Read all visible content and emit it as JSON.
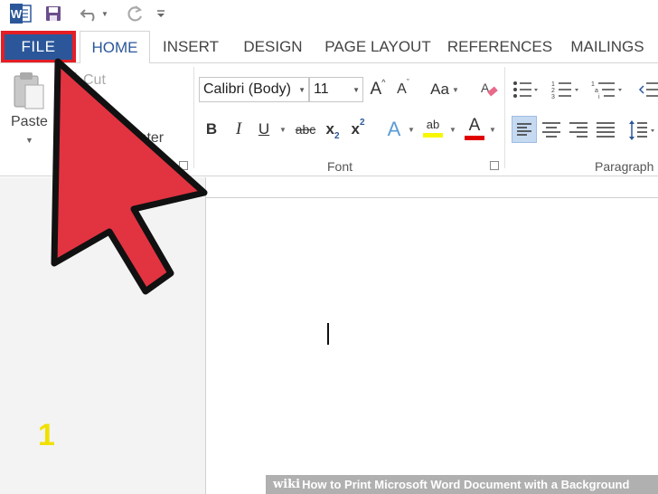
{
  "qat": {
    "app_icon_letter": "W",
    "icons": [
      "word-logo-icon",
      "save-icon",
      "undo-icon",
      "redo-icon",
      "customize-icon"
    ]
  },
  "tabs": {
    "file": "FILE",
    "items": [
      {
        "label": "HOME",
        "active": true
      },
      {
        "label": "INSERT",
        "active": false
      },
      {
        "label": "DESIGN",
        "active": false
      },
      {
        "label": "PAGE LAYOUT",
        "active": false
      },
      {
        "label": "REFERENCES",
        "active": false
      },
      {
        "label": "MAILINGS",
        "active": false
      }
    ]
  },
  "clipboard": {
    "paste": "Paste",
    "cut": "Cut",
    "format_painter_fragment": "inter"
  },
  "font": {
    "group_label": "Font",
    "font_name": "Calibri (Body)",
    "font_size": "11",
    "bold": "B",
    "italic": "I",
    "underline": "U",
    "strikethrough": "abc",
    "subscript": "x",
    "subscript_mark": "2",
    "superscript": "x",
    "superscript_mark": "2",
    "grow": "A",
    "shrink": "A",
    "change_case": "Aa",
    "text_effects": "A",
    "highlight": "ab",
    "font_color": "A"
  },
  "paragraph": {
    "group_label": "Paragraph"
  },
  "colors": {
    "file_tab": "#2b579a",
    "file_highlight": "#e51e25",
    "arrow_fill": "#e23341",
    "step_number": "#f0e000",
    "highlight_yellow": "#f7f700",
    "font_color_red": "#e00000"
  },
  "step_number": "1",
  "watermark": {
    "wiki": "wiki",
    "how": "How",
    "title": " to Print Microsoft Word Document with a Background"
  }
}
